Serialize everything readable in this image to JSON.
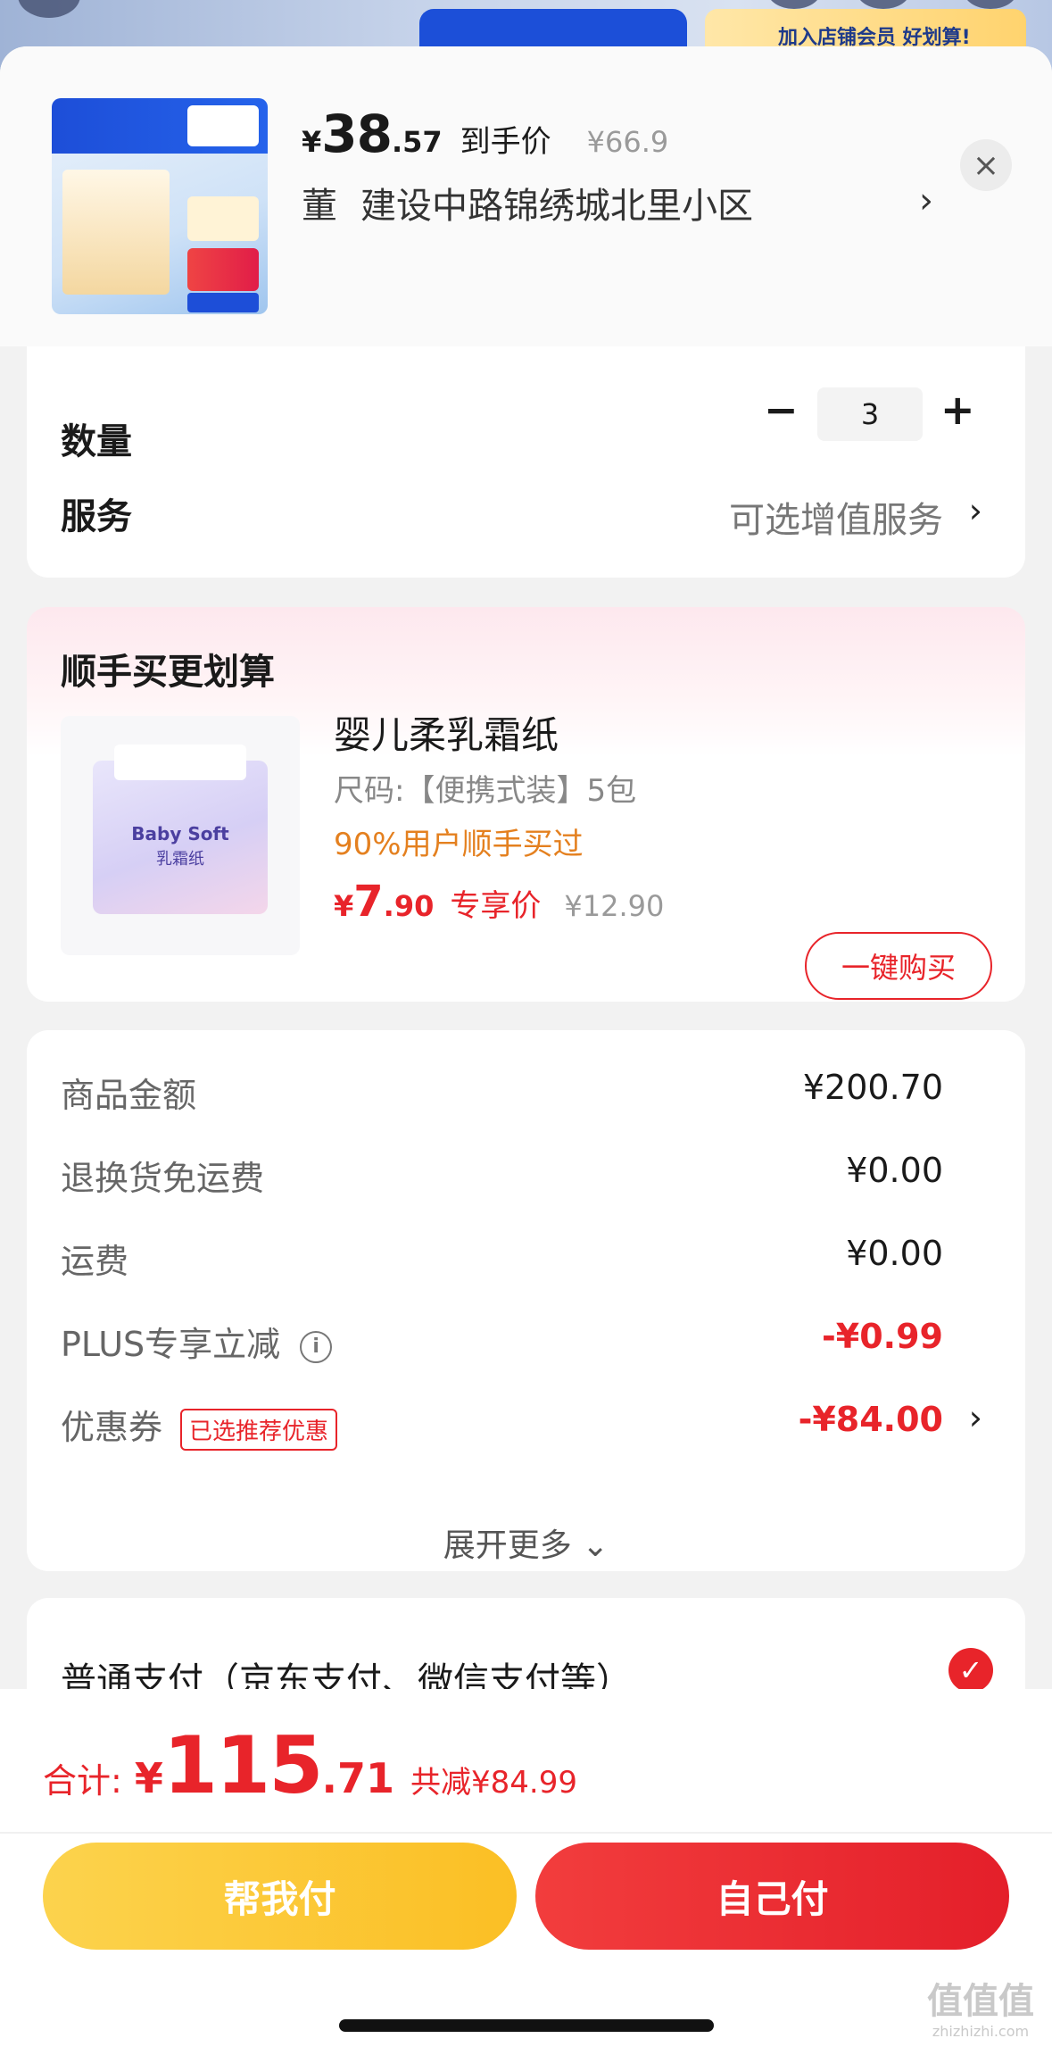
{
  "backdrop": {
    "banner_text": "加入店铺会员 好划算!"
  },
  "header": {
    "price_currency": "¥",
    "price_int": "38",
    "price_dec": ".57",
    "price_label": "到手价",
    "orig_price": "¥66.9",
    "close_icon": "×",
    "address_name": "董",
    "address": "建设中路锦绣城北里小区",
    "address_chevron": "›"
  },
  "options": {
    "quantity_label": "数量",
    "quantity_value": "3",
    "minus": "−",
    "plus": "+",
    "service_label": "服务",
    "service_value": "可选增值服务",
    "chevron": "›"
  },
  "addon": {
    "title": "顺手买更划算",
    "product_name": "婴儿柔乳霜纸",
    "spec": "尺码:【便携式装】5包",
    "popularity": "90%用户顺手买过",
    "price_currency": "¥",
    "price_int": "7",
    "price_dec": ".90",
    "price_label": "专享价",
    "orig_price": "¥12.90",
    "buy_button": "一键购买",
    "image_text": "Baby Soft",
    "image_subtext": "乳霜纸"
  },
  "fees": {
    "rows": [
      {
        "label": "商品金额",
        "value": "¥200.70"
      },
      {
        "label": "退换货免运费",
        "value": "¥0.00"
      },
      {
        "label": "运费",
        "value": "¥0.00"
      },
      {
        "label": "PLUS专享立减",
        "value": "-¥0.99"
      },
      {
        "label": "优惠券",
        "value": "-¥84.00"
      }
    ],
    "info_icon": "i",
    "coupon_badge": "已选推荐优惠",
    "chevron": "›",
    "expand": "展开更多 ⌄"
  },
  "payment": {
    "label": "普通支付（京东支付、微信支付等）",
    "check_icon": "✓"
  },
  "bottom": {
    "total_label": "合计:",
    "total_currency": "¥",
    "total_int": "115",
    "total_dec": ".71",
    "total_savings": "共减¥84.99",
    "help_pay": "帮我付",
    "self_pay": "自己付",
    "watermark": "值值值",
    "watermark_domain": "zhizhizhi.com"
  },
  "colors": {
    "accent_red": "#e8242a",
    "accent_orange": "#e4801f",
    "help_button": "#fbbf24"
  }
}
